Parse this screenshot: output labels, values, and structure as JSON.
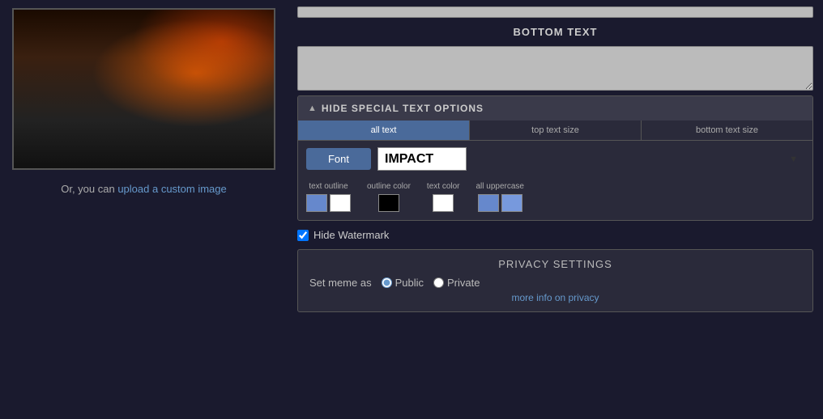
{
  "left": {
    "upload_text": "Or, you can ",
    "upload_link": "upload a custom image"
  },
  "right": {
    "bottom_text_label": "BOTTOM TEXT",
    "top_text_placeholder": "",
    "bottom_text_placeholder": "",
    "special_options": {
      "header": "HIDE SPECIAL TEXT OPTIONS",
      "arrow": "▲",
      "tabs": [
        {
          "label": "all text",
          "active": true
        },
        {
          "label": "top text size",
          "active": false
        },
        {
          "label": "bottom text size",
          "active": false
        }
      ],
      "font_label": "Font",
      "font_value": "IMPACT",
      "color_options": [
        {
          "label": "text outline",
          "swatches": [
            "blue",
            "white"
          ]
        },
        {
          "label": "outline color",
          "swatches": [
            "black"
          ]
        },
        {
          "label": "text color",
          "swatches": [
            "white"
          ]
        },
        {
          "label": "all uppercase",
          "swatches": [
            "blue",
            "blue2"
          ]
        }
      ]
    },
    "watermark": {
      "label": "Hide Watermark",
      "checked": true
    },
    "privacy": {
      "title": "PRIVACY SETTINGS",
      "set_meme_as_label": "Set meme as",
      "options": [
        {
          "label": "Public",
          "value": "public",
          "checked": true
        },
        {
          "label": "Private",
          "value": "private",
          "checked": false
        }
      ],
      "more_info_text": "more info on privacy"
    }
  }
}
